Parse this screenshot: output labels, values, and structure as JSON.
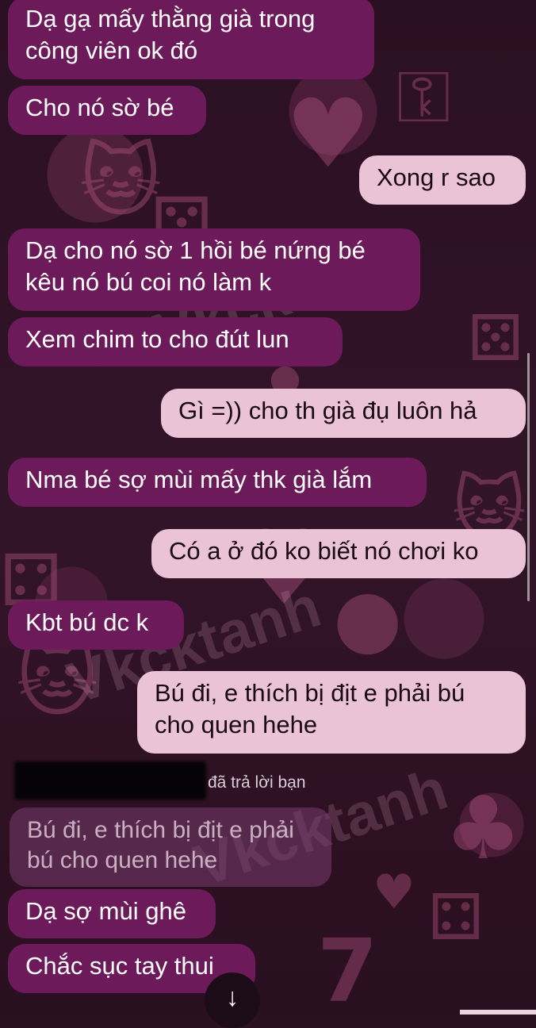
{
  "messages": [
    {
      "id": "m1",
      "side": "in",
      "text": "Dạ gạ mấy thằng già trong\ncông viên ok đó"
    },
    {
      "id": "m2",
      "side": "in",
      "text": "Cho nó sờ bé"
    },
    {
      "id": "m3",
      "side": "out",
      "text": "Xong r sao"
    },
    {
      "id": "m4",
      "side": "in",
      "text": "Dạ cho nó sờ 1 hồi bé nứng bé\nkêu nó bú coi nó làm k"
    },
    {
      "id": "m5",
      "side": "in",
      "text": "Xem chim to cho đút lun"
    },
    {
      "id": "m6",
      "side": "out",
      "text": "Gì =)) cho th già đụ luôn hả"
    },
    {
      "id": "m7",
      "side": "in",
      "text": "Nma bé sợ mùi mấy thk già lắm"
    },
    {
      "id": "m8",
      "side": "out",
      "text": "Có a ở đó ko biết nó chơi ko"
    },
    {
      "id": "m9",
      "side": "in",
      "text": "Kbt bú dc k"
    },
    {
      "id": "m10",
      "side": "out",
      "text": "Bú đi, e thích bị địt e phải bú\ncho quen hehe"
    },
    {
      "id": "m11",
      "side": "in",
      "text": "Dạ sợ mùi ghê"
    },
    {
      "id": "m12",
      "side": "in",
      "text": "Chắc sục tay thui"
    }
  ],
  "reply": {
    "label": "đã trả lời bạn",
    "quoted_text": "Bú đi, e thích bị địt e phải bú cho quen hehe"
  },
  "watermark": "Vkcktanh",
  "scroll_down_icon": "↓",
  "colors": {
    "incoming_bubble": "#6c1a5a",
    "outgoing_bubble": "#eac3d6",
    "background": "#2b0f22"
  }
}
